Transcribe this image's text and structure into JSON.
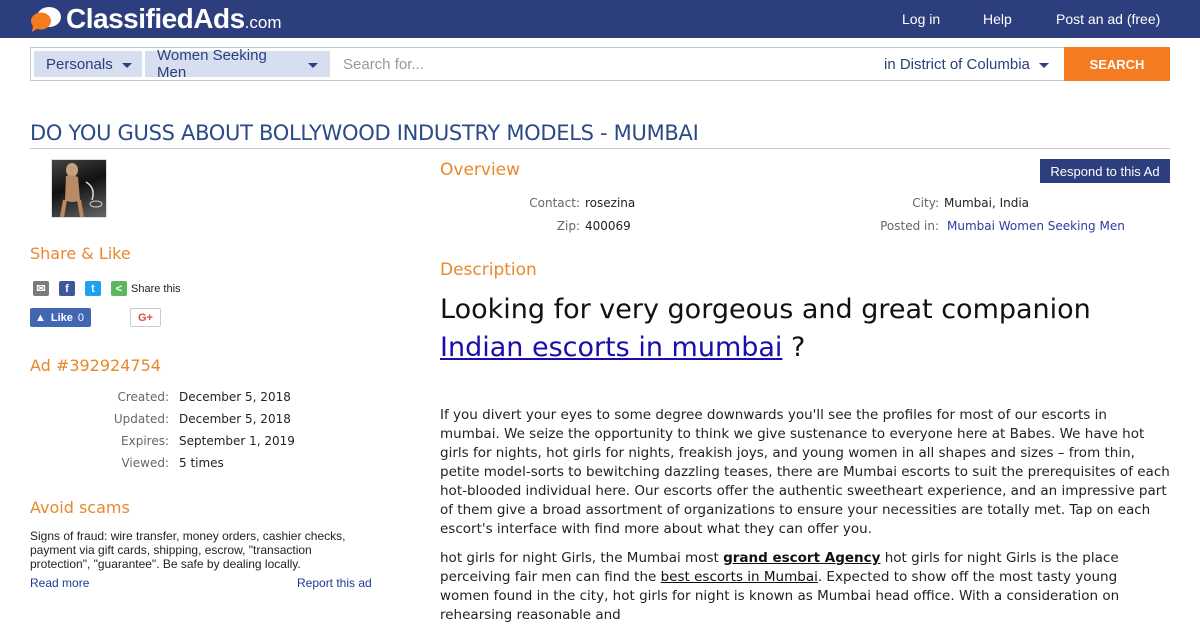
{
  "header": {
    "logo_text": "ClassifiedAds",
    "logo_suffix": ".com",
    "nav": [
      "Log in",
      "Help",
      "Post an ad (free)"
    ]
  },
  "search": {
    "category": "Personals",
    "subcategory": "Women Seeking Men",
    "placeholder": "Search for...",
    "location": "in District of Columbia",
    "button": "SEARCH"
  },
  "ad": {
    "title": "DO YOU GUSS ABOUT BOLLYWOOD INDUSTRY MODELS - MUMBAI"
  },
  "left": {
    "share_heading": "Share & Like",
    "share_text": "Share this",
    "like_label": "Like",
    "like_count": "0",
    "gplus_label": "G+",
    "ad_number_heading": "Ad #392924754",
    "meta": [
      {
        "k": "Created:",
        "v": "December 5, 2018"
      },
      {
        "k": "Updated:",
        "v": "December 5, 2018"
      },
      {
        "k": "Expires:",
        "v": "September 1, 2019"
      },
      {
        "k": "Viewed:",
        "v": "5 times"
      }
    ],
    "scams_heading": "Avoid scams",
    "scams_text": "Signs of fraud: wire transfer, money orders, cashier checks, payment via gift cards, shipping, escrow, \"transaction protection\", \"guarantee\". Be safe by dealing locally.",
    "read_more": "Read more",
    "report": "Report this ad"
  },
  "overview": {
    "heading": "Overview",
    "respond_button": "Respond to this Ad",
    "contact_label": "Contact:",
    "contact": "rosezina",
    "zip_label": "Zip:",
    "zip": "400069",
    "city_label": "City:",
    "city": "Mumbai, India",
    "posted_label": "Posted in:",
    "posted_in": "Mumbai Women Seeking Men"
  },
  "description": {
    "heading": "Description",
    "headline_pre": "Looking for very gorgeous and great companion ",
    "headline_link": "Indian escorts in mumbai",
    "headline_post": " ?",
    "p1": "If you divert your eyes to some degree downwards you'll see the profiles for most of our escorts in mumbai. We seize the opportunity to think we give sustenance to everyone here at Babes. We have hot girls for nights, hot girls for nights, freakish joys, and young women in all shapes and sizes – from thin, petite model-sorts to bewitching dazzling teases, there are Mumbai escorts to suit the prerequisites of each hot-blooded individual here. Our escorts offer the authentic sweetheart experience, and an impressive part of them give a broad assortment of organizations to ensure your necessities are totally met. Tap on each escort's interface with find more about what they can offer you.",
    "p2_a": "hot girls for night Girls, the Mumbai most ",
    "p2_link1": "grand escort Agency",
    "p2_b": " hot girls for night Girls is the place perceiving fair men can find the ",
    "p2_link2": "best escorts in Mumbai",
    "p2_c": ". Expected to show off the most tasty young women found in the city, hot girls for night is known as Mumbai head office. With a consideration on rehearsing reasonable and"
  },
  "colors": {
    "header_bg": "#2c3e7e",
    "accent_orange": "#f47b20",
    "section_heading": "#e8882c",
    "title_blue": "#2c4a85"
  }
}
